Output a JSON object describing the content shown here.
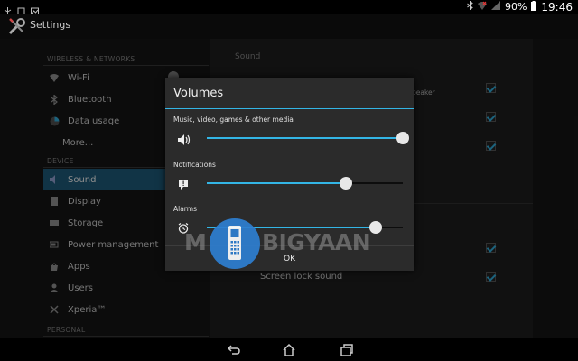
{
  "status_bar": {
    "battery": "90%",
    "time": "19:46"
  },
  "action_bar": {
    "title": "Settings"
  },
  "nav": {
    "wireless_header": "WIRELESS & NETWORKS",
    "device_header": "DEVICE",
    "personal_header": "PERSONAL",
    "wifi": "Wi-Fi",
    "bluetooth": "Bluetooth",
    "data_usage": "Data usage",
    "more": "More...",
    "sound": "Sound",
    "display": "Display",
    "storage": "Storage",
    "power": "Power management",
    "apps": "Apps",
    "users": "Users",
    "xperia": "Xperia™"
  },
  "right_pane": {
    "title": "Sound",
    "speaker_fragment": "peaker",
    "screen_lock": "Screen lock sound"
  },
  "dialog": {
    "title": "Volumes",
    "media_label": "Music, video, games & other media",
    "notifications_label": "Notifications",
    "alarms_label": "Alarms",
    "media_level": 1.0,
    "notifications_level": 0.71,
    "alarms_level": 0.86,
    "ok_label": "OK"
  },
  "watermark": {
    "prefix": "M",
    "text": "BIGYAAN"
  },
  "colors": {
    "accent": "#33b5e5",
    "selected": "#1f5f80",
    "watermark_blue": "#2e7fd1"
  }
}
